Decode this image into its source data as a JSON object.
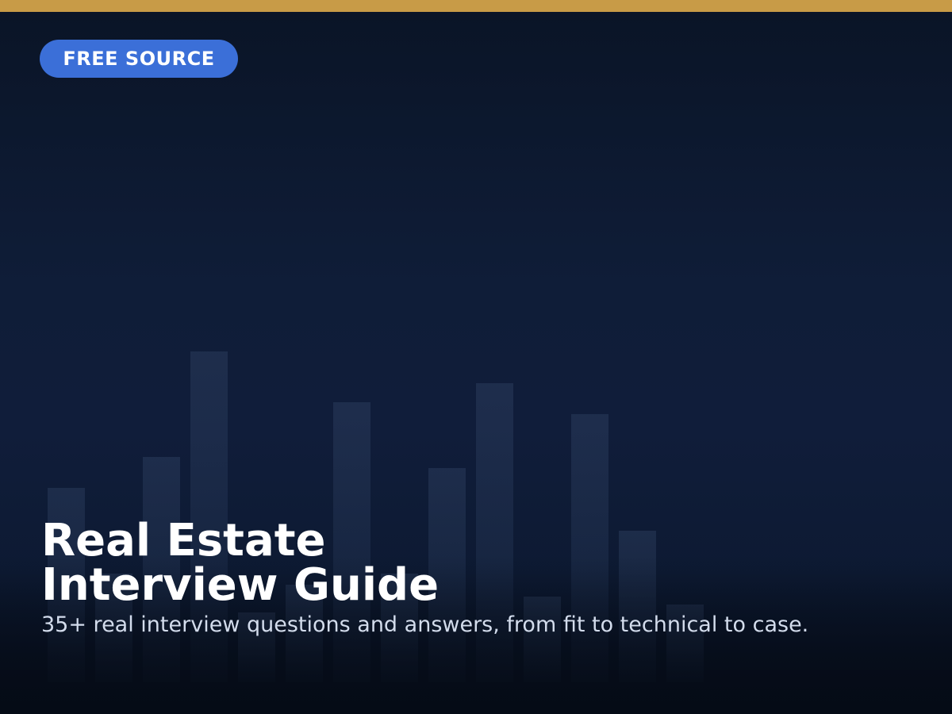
{
  "badge": {
    "label": "FREE SOURCE"
  },
  "hero": {
    "title_line1": "Real Estate",
    "title_line2": "Interview Guide",
    "subtitle": "35+ real interview questions and answers, from fit to technical to case."
  },
  "colors": {
    "accent_bar": "#c89b47",
    "badge_bg": "#3b6fd8",
    "background": "#0f1d38",
    "title": "#ffffff",
    "subtitle": "#d3dcec"
  },
  "decor": {
    "bar_heights": [
      0.5,
      0.28,
      0.58,
      0.85,
      0.18,
      0.25,
      0.72,
      0.28,
      0.55,
      0.77,
      0.22,
      0.69,
      0.39,
      0.2
    ]
  }
}
